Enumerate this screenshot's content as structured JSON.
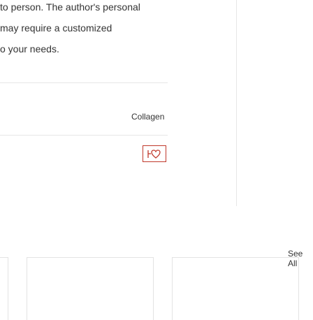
{
  "article": {
    "lines": [
      "to person. The author's personal",
      "may require a customized",
      "o your needs."
    ]
  },
  "product": {
    "tag": "Collagen",
    "icon": "heart-icon",
    "icon_color": "#c0392b"
  },
  "section": {
    "see_all_label": "See All"
  }
}
